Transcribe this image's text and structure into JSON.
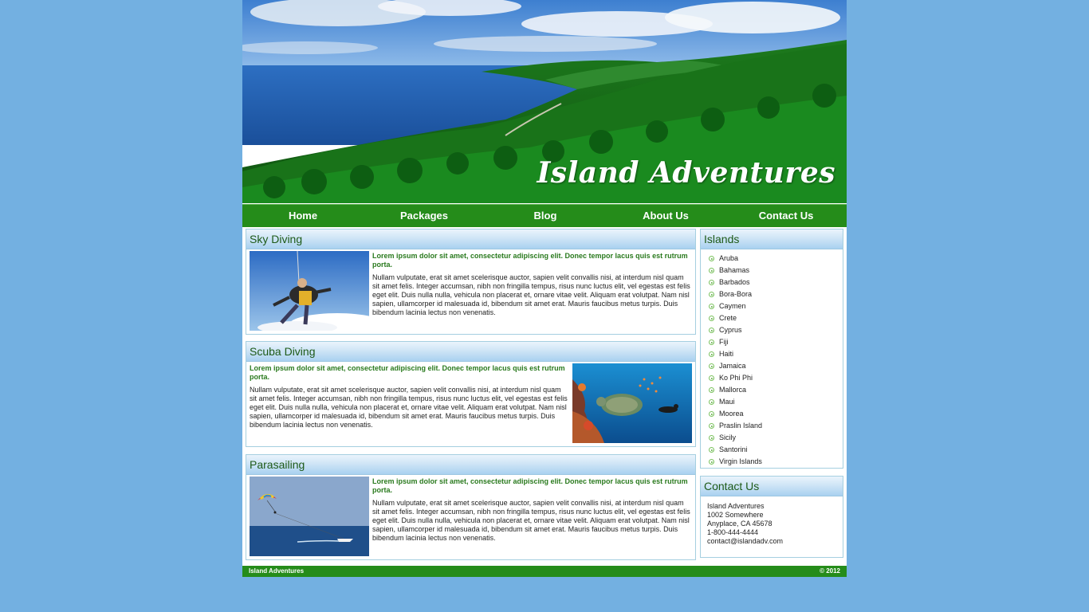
{
  "site": {
    "title": "Island Adventures"
  },
  "nav": [
    "Home",
    "Packages",
    "Blog",
    "About Us",
    "Contact Us"
  ],
  "activities": [
    {
      "title": "Sky Diving",
      "lead": "Lorem ipsum dolor sit amet, consectetur adipiscing elit. Donec tempor lacus quis est rutrum porta.",
      "body": "Nullam vulputate, erat sit amet scelerisque auctor, sapien velit convallis nisi, at interdum nisl quam sit amet felis. Integer accumsan, nibh non fringilla tempus, risus nunc luctus elit, vel egestas est felis eget elit. Duis nulla nulla, vehicula non placerat et, ornare vitae velit. Aliquam erat volutpat. Nam nisl sapien, ullamcorper id malesuada id, bibendum sit amet erat. Mauris faucibus metus turpis. Duis bibendum lacinia lectus non venenatis."
    },
    {
      "title": "Scuba Diving",
      "lead": "Lorem ipsum dolor sit amet, consectetur adipiscing elit. Donec tempor lacus quis est rutrum porta.",
      "body": "Nullam vulputate, erat sit amet scelerisque auctor, sapien velit convallis nisi, at interdum nisl quam sit amet felis. Integer accumsan, nibh non fringilla tempus, risus nunc luctus elit, vel egestas est felis eget elit. Duis nulla nulla, vehicula non placerat et, ornare vitae velit. Aliquam erat volutpat. Nam nisl sapien, ullamcorper id malesuada id, bibendum sit amet erat. Mauris faucibus metus turpis. Duis bibendum lacinia lectus non venenatis."
    },
    {
      "title": "Parasailing",
      "lead": "Lorem ipsum dolor sit amet, consectetur adipiscing elit. Donec tempor lacus quis est rutrum porta.",
      "body": "Nullam vulputate, erat sit amet scelerisque auctor, sapien velit convallis nisi, at interdum nisl quam sit amet felis. Integer accumsan, nibh non fringilla tempus, risus nunc luctus elit, vel egestas est felis eget elit. Duis nulla nulla, vehicula non placerat et, ornare vitae velit. Aliquam erat volutpat. Nam nisl sapien, ullamcorper id malesuada id, bibendum sit amet erat. Mauris faucibus metus turpis. Duis bibendum lacinia lectus non venenatis."
    }
  ],
  "islands": {
    "title": "Islands",
    "items": [
      "Aruba",
      "Bahamas",
      "Barbados",
      "Bora-Bora",
      "Caymen",
      "Crete",
      "Cyprus",
      "Fiji",
      "Haiti",
      "Jamaica",
      "Ko Phi Phi",
      "Mallorca",
      "Maui",
      "Moorea",
      "Praslin Island",
      "Sicily",
      "Santorini",
      "Virgin Islands"
    ]
  },
  "contact": {
    "title": "Contact Us",
    "lines": [
      "Island Adventures",
      "1002 Somewhere",
      "Anyplace, CA 45678",
      "1-800-444-4444",
      "contact@islandadv.com"
    ]
  },
  "footer": {
    "left": "Island Adventures",
    "right": "© 2012"
  },
  "colors": {
    "background": "#73b0e1",
    "nav_green": "#258c1a",
    "heading_green": "#1e5a18",
    "lead_green": "#2a7a1e"
  },
  "icons": {
    "list_bullet": "arrow-bullet-icon"
  }
}
